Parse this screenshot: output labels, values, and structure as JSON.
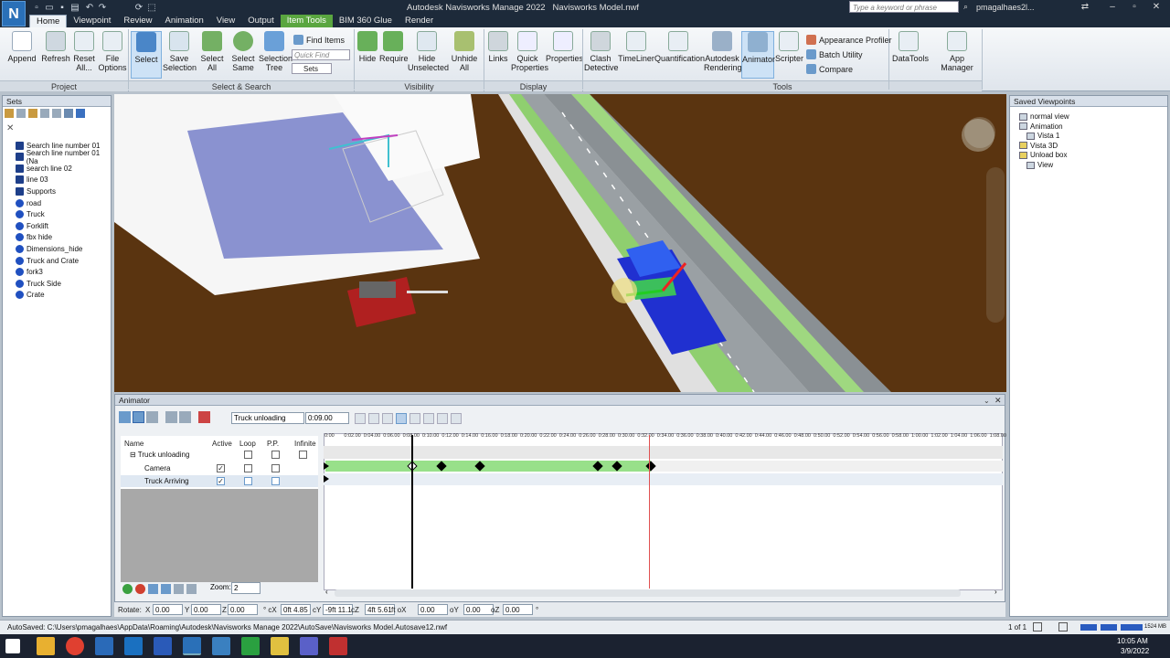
{
  "app": {
    "logo": "N",
    "title": "Autodesk Navisworks Manage 2022",
    "file": "Navisworks Model.nwf",
    "search_placeholder": "Type a keyword or phrase",
    "user": "pmagalhaes2l..."
  },
  "tabs": [
    "Home",
    "Viewpoint",
    "Review",
    "Animation",
    "View",
    "Output",
    "Item Tools",
    "BIM 360 Glue",
    "Render"
  ],
  "active_tab": "Home",
  "context_tab": "Item Tools",
  "ribbon": {
    "project": {
      "label": "Project",
      "buttons": [
        "Append",
        "Refresh",
        "Reset All...",
        "File Options"
      ]
    },
    "select_search": {
      "label": "Select & Search",
      "buttons": [
        "Select",
        "Save Selection",
        "Select All",
        "Select Same",
        "Selection Tree"
      ],
      "find_items": "Find Items",
      "quick_find": "Quick Find",
      "sets": "Sets"
    },
    "visibility": {
      "label": "Visibility",
      "buttons": [
        "Hide",
        "Require",
        "Hide Unselected",
        "Unhide All"
      ]
    },
    "display": {
      "label": "Display",
      "buttons": [
        "Links",
        "Quick Properties",
        "Properties"
      ]
    },
    "tools": {
      "label": "Tools",
      "buttons": [
        "Clash Detective",
        "TimeLiner",
        "Quantification",
        "Autodesk Rendering",
        "Animator",
        "Scripter"
      ],
      "small": [
        "Appearance Profiler",
        "Batch Utility",
        "Compare"
      ]
    },
    "extra": [
      "DataTools",
      "App Manager"
    ]
  },
  "sets_panel": {
    "title": "Sets",
    "items": [
      "Search line number 01",
      "Search line number 01 (Na",
      "search line 02",
      "line 03",
      "Supports",
      "road",
      "Truck",
      "Forklift",
      "fbx hide",
      "Dimensions_hide",
      "Truck and Crate",
      "fork3",
      "Truck Side",
      "Crate"
    ]
  },
  "viewpoints_panel": {
    "title": "Saved Viewpoints",
    "items": [
      "normal view",
      "Animation",
      "Vista 1",
      "Vista 3D",
      "Unload box",
      "View"
    ]
  },
  "animator": {
    "title": "Animator",
    "scene_select": "Truck unloading",
    "time": "0:09.00",
    "columns": [
      "Name",
      "Active",
      "Loop",
      "P.P.",
      "Infinite"
    ],
    "rows": [
      {
        "name": "Truck unloading",
        "active": false,
        "loop": false,
        "pp": false,
        "infinite": false
      },
      {
        "name": "Camera",
        "active": true,
        "loop": false,
        "pp": false
      },
      {
        "name": "Truck Arriving",
        "active": true,
        "loop": false,
        "pp": false
      }
    ],
    "zoom_label": "Zoom:",
    "zoom_value": "2",
    "ticks": [
      "0:00",
      "0:02.00",
      "0:04.00",
      "0:06.00",
      "0:08.00",
      "0:10.00",
      "0:12.00",
      "0:14.00",
      "0:16.00",
      "0:18.00",
      "0:20.00",
      "0:22.00",
      "0:24.00",
      "0:26.00",
      "0:28.00",
      "0:30.00",
      "0:32.00",
      "0:34.00",
      "0:36.00",
      "0:38.00",
      "0:40.00",
      "0:42.00",
      "0:44.00",
      "0:46.00",
      "0:48.00",
      "0:50.00",
      "0:52.00",
      "0:54.00",
      "0:56.00",
      "0:58.00",
      "1:00.00",
      "1:02.00",
      "1:04.00",
      "1:06.00",
      "1:08.00"
    ]
  },
  "rotate_bar": {
    "label": "Rotate:",
    "fields": [
      {
        "label": "X",
        "value": "0.00"
      },
      {
        "label": "Y",
        "value": "0.00"
      },
      {
        "label": "Z",
        "value": "0.00"
      },
      {
        "label": "° cX",
        "value": "0ft 4.85"
      },
      {
        "label": "cY",
        "value": "-9ft 11.1"
      },
      {
        "label": "cZ",
        "value": "4ft 5.61"
      },
      {
        "label": "ft  oX",
        "value": "0.00"
      },
      {
        "label": "oY",
        "value": "0.00"
      },
      {
        "label": "oZ",
        "value": "0.00"
      }
    ],
    "degree": "°"
  },
  "status": {
    "autosave": "AutoSaved: C:\\Users\\pmagalhaes\\AppData\\Roaming\\Autodesk\\Navisworks Manage 2022\\AutoSave\\Navisworks Model.Autosave12.nwf",
    "page": "1 of 1",
    "memory": "1524 MB"
  },
  "taskbar": {
    "time": "10:05 AM",
    "date": "3/9/2022"
  },
  "colors": {
    "accent": "#5aa640",
    "timeline_bar": "#98e08a",
    "playhead_end": "#e05050"
  }
}
